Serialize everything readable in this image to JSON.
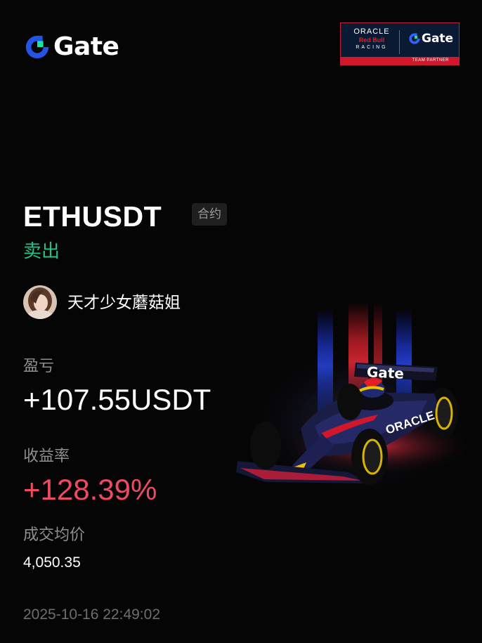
{
  "brand": {
    "name": "Gate"
  },
  "partner_badge": {
    "oracle": "ORACLE",
    "red_bull": "Red Bull",
    "racing": "RACING",
    "gate": "Gate",
    "team_partner": "TEAM PARTNER"
  },
  "position": {
    "symbol": "ETHUSDT",
    "type_badge": "合约",
    "side": "卖出",
    "side_color": "#25c285"
  },
  "user": {
    "name": "天才少女蘑菇姐"
  },
  "stats": {
    "pnl_label": "盈亏",
    "pnl_value": "+107.55USDT",
    "roi_label": "收益率",
    "roi_value": "+128.39%",
    "roi_color": "#ef4a63",
    "avg_price_label": "成交均价",
    "avg_price_value": "4,050.35"
  },
  "timestamp": "2025-10-16 22:49:02",
  "car_livery": {
    "sponsor": "Gate",
    "sidepod": "ORACLE"
  },
  "icons": {
    "brand_logo": "gate-logo-icon",
    "avatar": "user-avatar",
    "illustration": "red-bull-f1-car"
  }
}
